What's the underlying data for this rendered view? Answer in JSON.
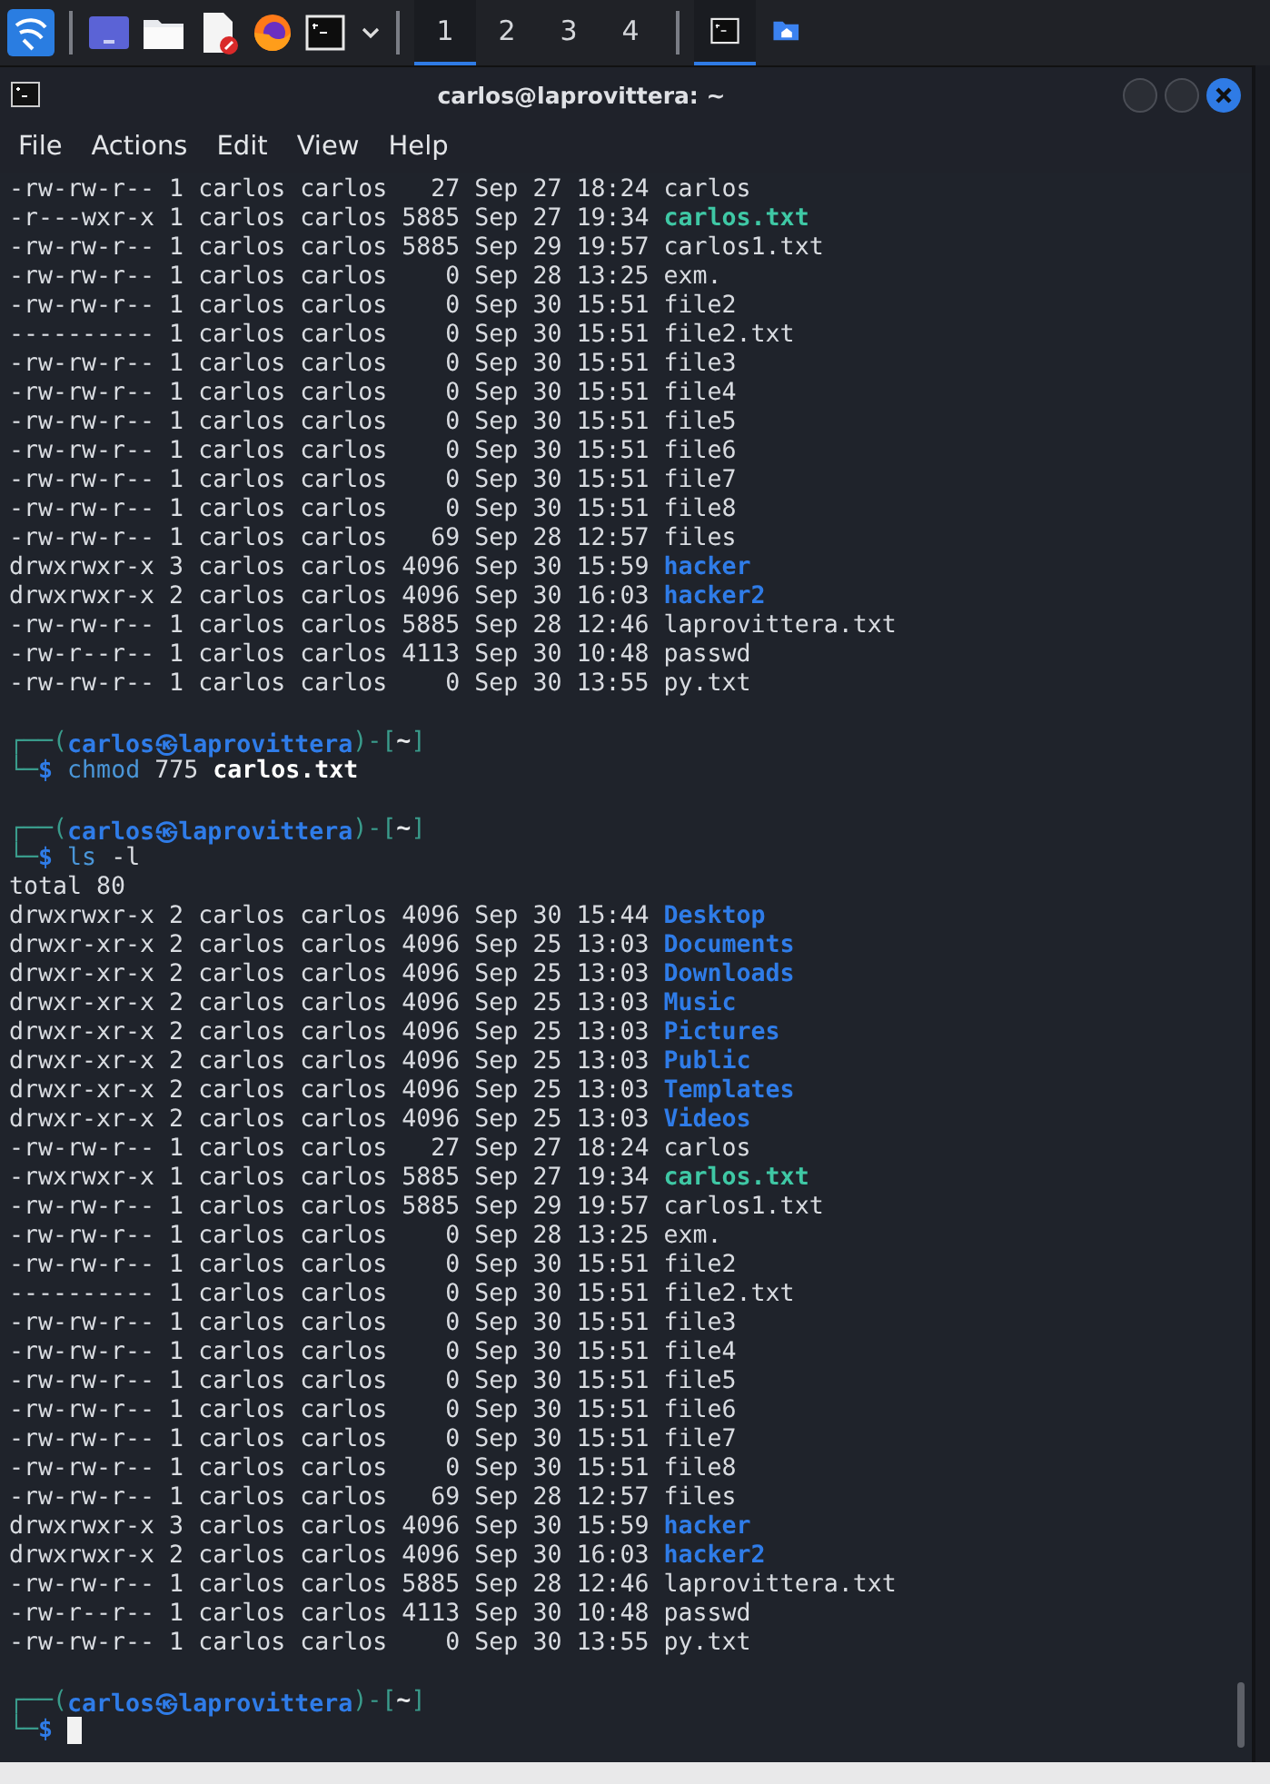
{
  "taskbar": {
    "launchers": [
      {
        "kind": "menu"
      },
      {
        "kind": "desktop"
      },
      {
        "kind": "folder"
      },
      {
        "kind": "editor"
      },
      {
        "kind": "browser"
      },
      {
        "kind": "terminal"
      }
    ],
    "workspaces": [
      {
        "label": "1",
        "selected": true
      },
      {
        "label": "2",
        "selected": false
      },
      {
        "label": "3",
        "selected": false
      },
      {
        "label": "4",
        "selected": false
      }
    ],
    "tasks": [
      {
        "kind": "terminal",
        "selected": true
      },
      {
        "kind": "home",
        "selected": false
      }
    ]
  },
  "window": {
    "title": "carlos@laprovittera: ~",
    "menu": [
      "File",
      "Actions",
      "Edit",
      "View",
      "Help"
    ]
  },
  "terminal": {
    "lines": [
      {
        "kind": "file",
        "meta": "-rw-rw-r-- 1 carlos carlos   27 Sep 27 18:24",
        "name": "carlos"
      },
      {
        "kind": "exec",
        "meta": "-r---wxr-x 1 carlos carlos 5885 Sep 27 19:34",
        "name": "carlos.txt"
      },
      {
        "kind": "file",
        "meta": "-rw-rw-r-- 1 carlos carlos 5885 Sep 29 19:57",
        "name": "carlos1.txt"
      },
      {
        "kind": "file",
        "meta": "-rw-rw-r-- 1 carlos carlos    0 Sep 28 13:25",
        "name": "exm."
      },
      {
        "kind": "file",
        "meta": "-rw-rw-r-- 1 carlos carlos    0 Sep 30 15:51",
        "name": "file2"
      },
      {
        "kind": "file",
        "meta": "---------- 1 carlos carlos    0 Sep 30 15:51",
        "name": "file2.txt"
      },
      {
        "kind": "file",
        "meta": "-rw-rw-r-- 1 carlos carlos    0 Sep 30 15:51",
        "name": "file3"
      },
      {
        "kind": "file",
        "meta": "-rw-rw-r-- 1 carlos carlos    0 Sep 30 15:51",
        "name": "file4"
      },
      {
        "kind": "file",
        "meta": "-rw-rw-r-- 1 carlos carlos    0 Sep 30 15:51",
        "name": "file5"
      },
      {
        "kind": "file",
        "meta": "-rw-rw-r-- 1 carlos carlos    0 Sep 30 15:51",
        "name": "file6"
      },
      {
        "kind": "file",
        "meta": "-rw-rw-r-- 1 carlos carlos    0 Sep 30 15:51",
        "name": "file7"
      },
      {
        "kind": "file",
        "meta": "-rw-rw-r-- 1 carlos carlos    0 Sep 30 15:51",
        "name": "file8"
      },
      {
        "kind": "file",
        "meta": "-rw-rw-r-- 1 carlos carlos   69 Sep 28 12:57",
        "name": "files"
      },
      {
        "kind": "dir",
        "meta": "drwxrwxr-x 3 carlos carlos 4096 Sep 30 15:59",
        "name": "hacker"
      },
      {
        "kind": "dir",
        "meta": "drwxrwxr-x 2 carlos carlos 4096 Sep 30 16:03",
        "name": "hacker2"
      },
      {
        "kind": "file",
        "meta": "-rw-rw-r-- 1 carlos carlos 5885 Sep 28 12:46",
        "name": "laprovittera.txt"
      },
      {
        "kind": "file",
        "meta": "-rw-r--r-- 1 carlos carlos 4113 Sep 30 10:48",
        "name": "passwd"
      },
      {
        "kind": "file",
        "meta": "-rw-rw-r-- 1 carlos carlos    0 Sep 30 13:55",
        "name": "py.txt"
      },
      {
        "kind": "blank"
      },
      {
        "kind": "prompt",
        "open": "┌──(",
        "user": "carlos",
        "at": "㉿",
        "host": "laprovittera",
        "mid": ")-[",
        "dir": "~",
        "close": "]",
        "corner": "└─",
        "sign": "$",
        "command": "chmod",
        "args": "775 **carlos.txt**",
        "cursor": false
      },
      {
        "kind": "blank"
      },
      {
        "kind": "prompt",
        "open": "┌──(",
        "user": "carlos",
        "at": "㉿",
        "host": "laprovittera",
        "mid": ")-[",
        "dir": "~",
        "close": "]",
        "corner": "└─",
        "sign": "$",
        "command": "ls",
        "args": "-l",
        "cursor": false
      },
      {
        "kind": "text",
        "text": "total 80"
      },
      {
        "kind": "dir",
        "meta": "drwxrwxr-x 2 carlos carlos 4096 Sep 30 15:44",
        "name": "Desktop"
      },
      {
        "kind": "dir",
        "meta": "drwxr-xr-x 2 carlos carlos 4096 Sep 25 13:03",
        "name": "Documents"
      },
      {
        "kind": "dir",
        "meta": "drwxr-xr-x 2 carlos carlos 4096 Sep 25 13:03",
        "name": "Downloads"
      },
      {
        "kind": "dir",
        "meta": "drwxr-xr-x 2 carlos carlos 4096 Sep 25 13:03",
        "name": "Music"
      },
      {
        "kind": "dir",
        "meta": "drwxr-xr-x 2 carlos carlos 4096 Sep 25 13:03",
        "name": "Pictures"
      },
      {
        "kind": "dir",
        "meta": "drwxr-xr-x 2 carlos carlos 4096 Sep 25 13:03",
        "name": "Public"
      },
      {
        "kind": "dir",
        "meta": "drwxr-xr-x 2 carlos carlos 4096 Sep 25 13:03",
        "name": "Templates"
      },
      {
        "kind": "dir",
        "meta": "drwxr-xr-x 2 carlos carlos 4096 Sep 25 13:03",
        "name": "Videos"
      },
      {
        "kind": "file",
        "meta": "-rw-rw-r-- 1 carlos carlos   27 Sep 27 18:24",
        "name": "carlos"
      },
      {
        "kind": "exec",
        "meta": "-rwxrwxr-x 1 carlos carlos 5885 Sep 27 19:34",
        "name": "carlos.txt"
      },
      {
        "kind": "file",
        "meta": "-rw-rw-r-- 1 carlos carlos 5885 Sep 29 19:57",
        "name": "carlos1.txt"
      },
      {
        "kind": "file",
        "meta": "-rw-rw-r-- 1 carlos carlos    0 Sep 28 13:25",
        "name": "exm."
      },
      {
        "kind": "file",
        "meta": "-rw-rw-r-- 1 carlos carlos    0 Sep 30 15:51",
        "name": "file2"
      },
      {
        "kind": "file",
        "meta": "---------- 1 carlos carlos    0 Sep 30 15:51",
        "name": "file2.txt"
      },
      {
        "kind": "file",
        "meta": "-rw-rw-r-- 1 carlos carlos    0 Sep 30 15:51",
        "name": "file3"
      },
      {
        "kind": "file",
        "meta": "-rw-rw-r-- 1 carlos carlos    0 Sep 30 15:51",
        "name": "file4"
      },
      {
        "kind": "file",
        "meta": "-rw-rw-r-- 1 carlos carlos    0 Sep 30 15:51",
        "name": "file5"
      },
      {
        "kind": "file",
        "meta": "-rw-rw-r-- 1 carlos carlos    0 Sep 30 15:51",
        "name": "file6"
      },
      {
        "kind": "file",
        "meta": "-rw-rw-r-- 1 carlos carlos    0 Sep 30 15:51",
        "name": "file7"
      },
      {
        "kind": "file",
        "meta": "-rw-rw-r-- 1 carlos carlos    0 Sep 30 15:51",
        "name": "file8"
      },
      {
        "kind": "file",
        "meta": "-rw-rw-r-- 1 carlos carlos   69 Sep 28 12:57",
        "name": "files"
      },
      {
        "kind": "dir",
        "meta": "drwxrwxr-x 3 carlos carlos 4096 Sep 30 15:59",
        "name": "hacker"
      },
      {
        "kind": "dir",
        "meta": "drwxrwxr-x 2 carlos carlos 4096 Sep 30 16:03",
        "name": "hacker2"
      },
      {
        "kind": "file",
        "meta": "-rw-rw-r-- 1 carlos carlos 5885 Sep 28 12:46",
        "name": "laprovittera.txt"
      },
      {
        "kind": "file",
        "meta": "-rw-r--r-- 1 carlos carlos 4113 Sep 30 10:48",
        "name": "passwd"
      },
      {
        "kind": "file",
        "meta": "-rw-rw-r-- 1 carlos carlos    0 Sep 30 13:55",
        "name": "py.txt"
      },
      {
        "kind": "blank"
      },
      {
        "kind": "prompt",
        "open": "┌──(",
        "user": "carlos",
        "at": "㉿",
        "host": "laprovittera",
        "mid": ")-[",
        "dir": "~",
        "close": "]",
        "corner": "└─",
        "sign": "$",
        "cursor": true
      }
    ]
  }
}
